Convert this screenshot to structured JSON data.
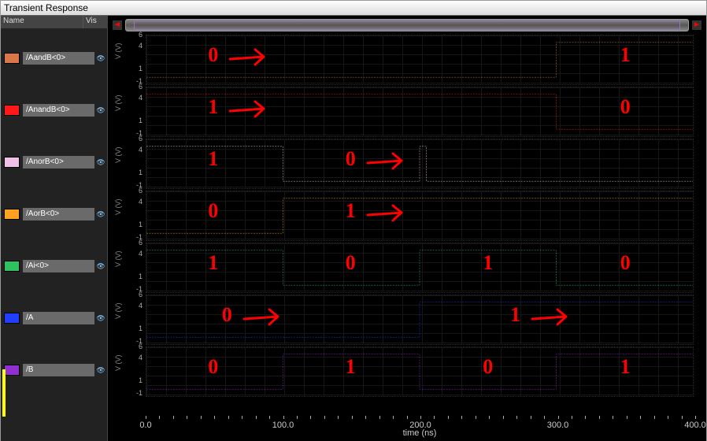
{
  "window": {
    "title": "Transient Response"
  },
  "sidebar": {
    "header": {
      "name": "Name",
      "vis": "Vis"
    },
    "signals": [
      {
        "name": "/AandB<0>",
        "color": "#d9764a"
      },
      {
        "name": "/AnandB<0>",
        "color": "#ff1a1a"
      },
      {
        "name": "/AnorB<0>",
        "color": "#f0c0e8"
      },
      {
        "name": "/AorB<0>",
        "color": "#ffa020"
      },
      {
        "name": "/Ai<0>",
        "color": "#30c060"
      },
      {
        "name": "/A",
        "color": "#2040ff"
      },
      {
        "name": "/B",
        "color": "#9030d0"
      }
    ]
  },
  "yaxis": {
    "label": "V (V)",
    "ticks": [
      "6",
      "4",
      "1",
      "-1"
    ]
  },
  "xaxis": {
    "label": "time (ns)",
    "ticks": [
      {
        "pos": 0,
        "label": "0.0"
      },
      {
        "pos": 0.25,
        "label": "100.0"
      },
      {
        "pos": 0.5,
        "label": "200.0"
      },
      {
        "pos": 0.75,
        "label": "300.0"
      },
      {
        "pos": 1.0,
        "label": "400.0"
      }
    ]
  },
  "chart_data": {
    "type": "line",
    "description": "Simulated transient digital waveforms, voltage (V) vs time (ns). Logic low ≈ 0 V, logic high ≈ 5 V. Red handwritten 0/1 annotations indicate logic value of each segment.",
    "xlabel": "time (ns)",
    "ylabel": "V (V)",
    "xlim": [
      0,
      400
    ],
    "ylim": [
      -1,
      6
    ],
    "series": [
      {
        "name": "/AandB<0>",
        "color": "#d9764a",
        "segments": [
          [
            0,
            0
          ],
          [
            300,
            0
          ],
          [
            300,
            5
          ],
          [
            400,
            5
          ]
        ]
      },
      {
        "name": "/AnandB<0>",
        "color": "#ff1a1a",
        "segments": [
          [
            0,
            5
          ],
          [
            300,
            5
          ],
          [
            300,
            0
          ],
          [
            400,
            0
          ]
        ]
      },
      {
        "name": "/AnorB<0>",
        "color": "#f0c0e8",
        "segments": [
          [
            0,
            5
          ],
          [
            100,
            5
          ],
          [
            100,
            0
          ],
          [
            200,
            0
          ],
          [
            200,
            5
          ],
          [
            205,
            5
          ],
          [
            205,
            0
          ],
          [
            400,
            0
          ]
        ]
      },
      {
        "name": "/AorB<0>",
        "color": "#ffa020",
        "segments": [
          [
            0,
            0
          ],
          [
            100,
            0
          ],
          [
            100,
            5
          ],
          [
            400,
            5
          ]
        ]
      },
      {
        "name": "/Ai<0>",
        "color": "#30c060",
        "segments": [
          [
            0,
            5
          ],
          [
            100,
            5
          ],
          [
            100,
            0
          ],
          [
            200,
            0
          ],
          [
            200,
            5
          ],
          [
            300,
            5
          ],
          [
            300,
            0
          ],
          [
            400,
            0
          ]
        ]
      },
      {
        "name": "/A",
        "color": "#2040ff",
        "segments": [
          [
            0,
            0
          ],
          [
            200,
            0
          ],
          [
            200,
            5
          ],
          [
            400,
            5
          ]
        ]
      },
      {
        "name": "/B",
        "color": "#9030d0",
        "segments": [
          [
            0,
            0
          ],
          [
            100,
            0
          ],
          [
            100,
            5
          ],
          [
            200,
            5
          ],
          [
            200,
            0
          ],
          [
            300,
            0
          ],
          [
            300,
            5
          ],
          [
            400,
            5
          ]
        ]
      }
    ],
    "annotations": [
      {
        "strip": 0,
        "items": [
          {
            "t": 50,
            "text": "0",
            "arrow": true
          },
          {
            "t": 350,
            "text": "1"
          }
        ]
      },
      {
        "strip": 1,
        "items": [
          {
            "t": 50,
            "text": "1",
            "arrow": true
          },
          {
            "t": 350,
            "text": "0"
          }
        ]
      },
      {
        "strip": 2,
        "items": [
          {
            "t": 50,
            "text": "1"
          },
          {
            "t": 150,
            "text": "0",
            "arrow": true
          }
        ]
      },
      {
        "strip": 3,
        "items": [
          {
            "t": 50,
            "text": "0"
          },
          {
            "t": 150,
            "text": "1",
            "arrow": true
          }
        ]
      },
      {
        "strip": 4,
        "items": [
          {
            "t": 50,
            "text": "1"
          },
          {
            "t": 150,
            "text": "0"
          },
          {
            "t": 250,
            "text": "1"
          },
          {
            "t": 350,
            "text": "0"
          }
        ]
      },
      {
        "strip": 5,
        "items": [
          {
            "t": 60,
            "text": "0",
            "arrow": true
          },
          {
            "t": 270,
            "text": "1",
            "arrow": true
          }
        ]
      },
      {
        "strip": 6,
        "items": [
          {
            "t": 50,
            "text": "0"
          },
          {
            "t": 150,
            "text": "1"
          },
          {
            "t": 250,
            "text": "0"
          },
          {
            "t": 350,
            "text": "1"
          }
        ]
      }
    ]
  }
}
